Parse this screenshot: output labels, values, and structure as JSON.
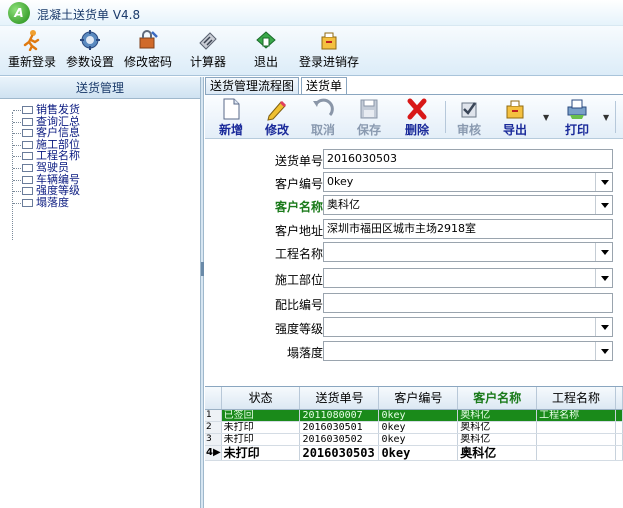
{
  "window": {
    "title": "混凝土送货单 V4.8",
    "logo_letter": "A"
  },
  "toolbar": {
    "items": [
      {
        "label": "重新登录",
        "icon": "person-run-icon"
      },
      {
        "label": "参数设置",
        "icon": "settings-icon"
      },
      {
        "label": "修改密码",
        "icon": "password-icon"
      },
      {
        "label": "计算器",
        "icon": "calculator-icon"
      },
      {
        "label": "退出",
        "icon": "exit-icon"
      },
      {
        "label": "登录进销存",
        "icon": "inventory-icon"
      }
    ]
  },
  "left_panel": {
    "header": "送货管理",
    "items": [
      {
        "label": "销售发货"
      },
      {
        "label": "查询汇总"
      },
      {
        "label": "客户信息"
      },
      {
        "label": "施工部位"
      },
      {
        "label": "工程名称"
      },
      {
        "label": "驾驶员"
      },
      {
        "label": "车辆编号"
      },
      {
        "label": "强度等级"
      },
      {
        "label": "塌落度"
      }
    ]
  },
  "tabs": [
    {
      "label": "送货管理流程图",
      "active": false
    },
    {
      "label": "送货单",
      "active": true
    }
  ],
  "inner_toolbar": {
    "buttons": [
      {
        "label": "新增",
        "enabled": true
      },
      {
        "label": "修改",
        "enabled": true
      },
      {
        "label": "取消",
        "enabled": false
      },
      {
        "label": "保存",
        "enabled": false
      },
      {
        "label": "删除",
        "enabled": true
      },
      {
        "label": "审核",
        "enabled": false
      },
      {
        "label": "导出",
        "enabled": true
      },
      {
        "label": "打印",
        "enabled": true
      }
    ]
  },
  "form": {
    "fields": [
      {
        "label": "送货单号",
        "value": "2016030503",
        "type": "text"
      },
      {
        "label": "客户编号",
        "value": "0key",
        "type": "combo"
      },
      {
        "label": "客户名称",
        "value": "奥科亿",
        "type": "combo",
        "highlight": true
      },
      {
        "label": "客户地址",
        "value": "深圳市福田区城市主场2918室",
        "type": "text"
      },
      {
        "label": "工程名称",
        "value": "",
        "type": "combo"
      },
      {
        "label": "施工部位",
        "value": "",
        "type": "combo"
      },
      {
        "label": "配比编号",
        "value": "",
        "type": "text"
      },
      {
        "label": "强度等级",
        "value": "",
        "type": "combo"
      },
      {
        "label": "塌落度",
        "value": "",
        "type": "combo"
      }
    ]
  },
  "grid": {
    "columns": [
      "状态",
      "送货单号",
      "客户编号",
      "客户名称",
      "工程名称"
    ],
    "rows": [
      {
        "num": "1",
        "status": "已签回",
        "order_no": "2011080007",
        "customer_no": "0key",
        "customer_name": "奥科亿",
        "project": "工程名称",
        "selected": true
      },
      {
        "num": "2",
        "status": "未打印",
        "order_no": "2016030501",
        "customer_no": "0key",
        "customer_name": "奥科亿",
        "project": ""
      },
      {
        "num": "3",
        "status": "未打印",
        "order_no": "2016030502",
        "customer_no": "0key",
        "customer_name": "奥科亿",
        "project": ""
      },
      {
        "num": "4",
        "status": "未打印",
        "order_no": "2016030503",
        "customer_no": "0key",
        "customer_name": "奥科亿",
        "project": "",
        "current": true
      }
    ]
  },
  "colors": {
    "accent_green": "#1a8a1a",
    "label_blue": "#1a2a9a"
  }
}
